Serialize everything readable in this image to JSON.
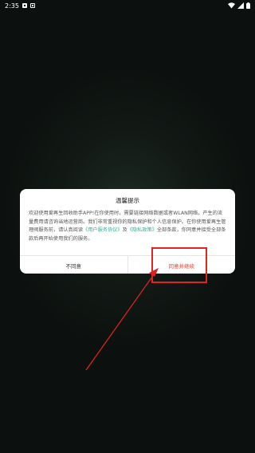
{
  "status_bar": {
    "time": "2:35"
  },
  "dialog": {
    "title": "温馨提示",
    "body": {
      "text_1": "欢迎使用爱再生回收助手APP!在你使用时，需要链接网络数据或者WLAN网络，产生的流量费用请咨询当地运营商。我们非常重视你的隐私保护和个人信息保护。在你使用爱再生管理阀服务前，请认真阅读",
      "link_user_agreement": "《用户服务协议》",
      "text_2": "及",
      "link_privacy_policy": "《隐私政策》",
      "text_3": "全部条款，你同意并接受全部条款后再开始使用我们的服务。"
    },
    "buttons": {
      "decline": "不同意",
      "agree": "同意并继续"
    }
  },
  "annotation": {
    "highlight_color": "#e12420"
  },
  "colors": {
    "link": "#2bb39a",
    "agree_text": "#e0403a"
  }
}
